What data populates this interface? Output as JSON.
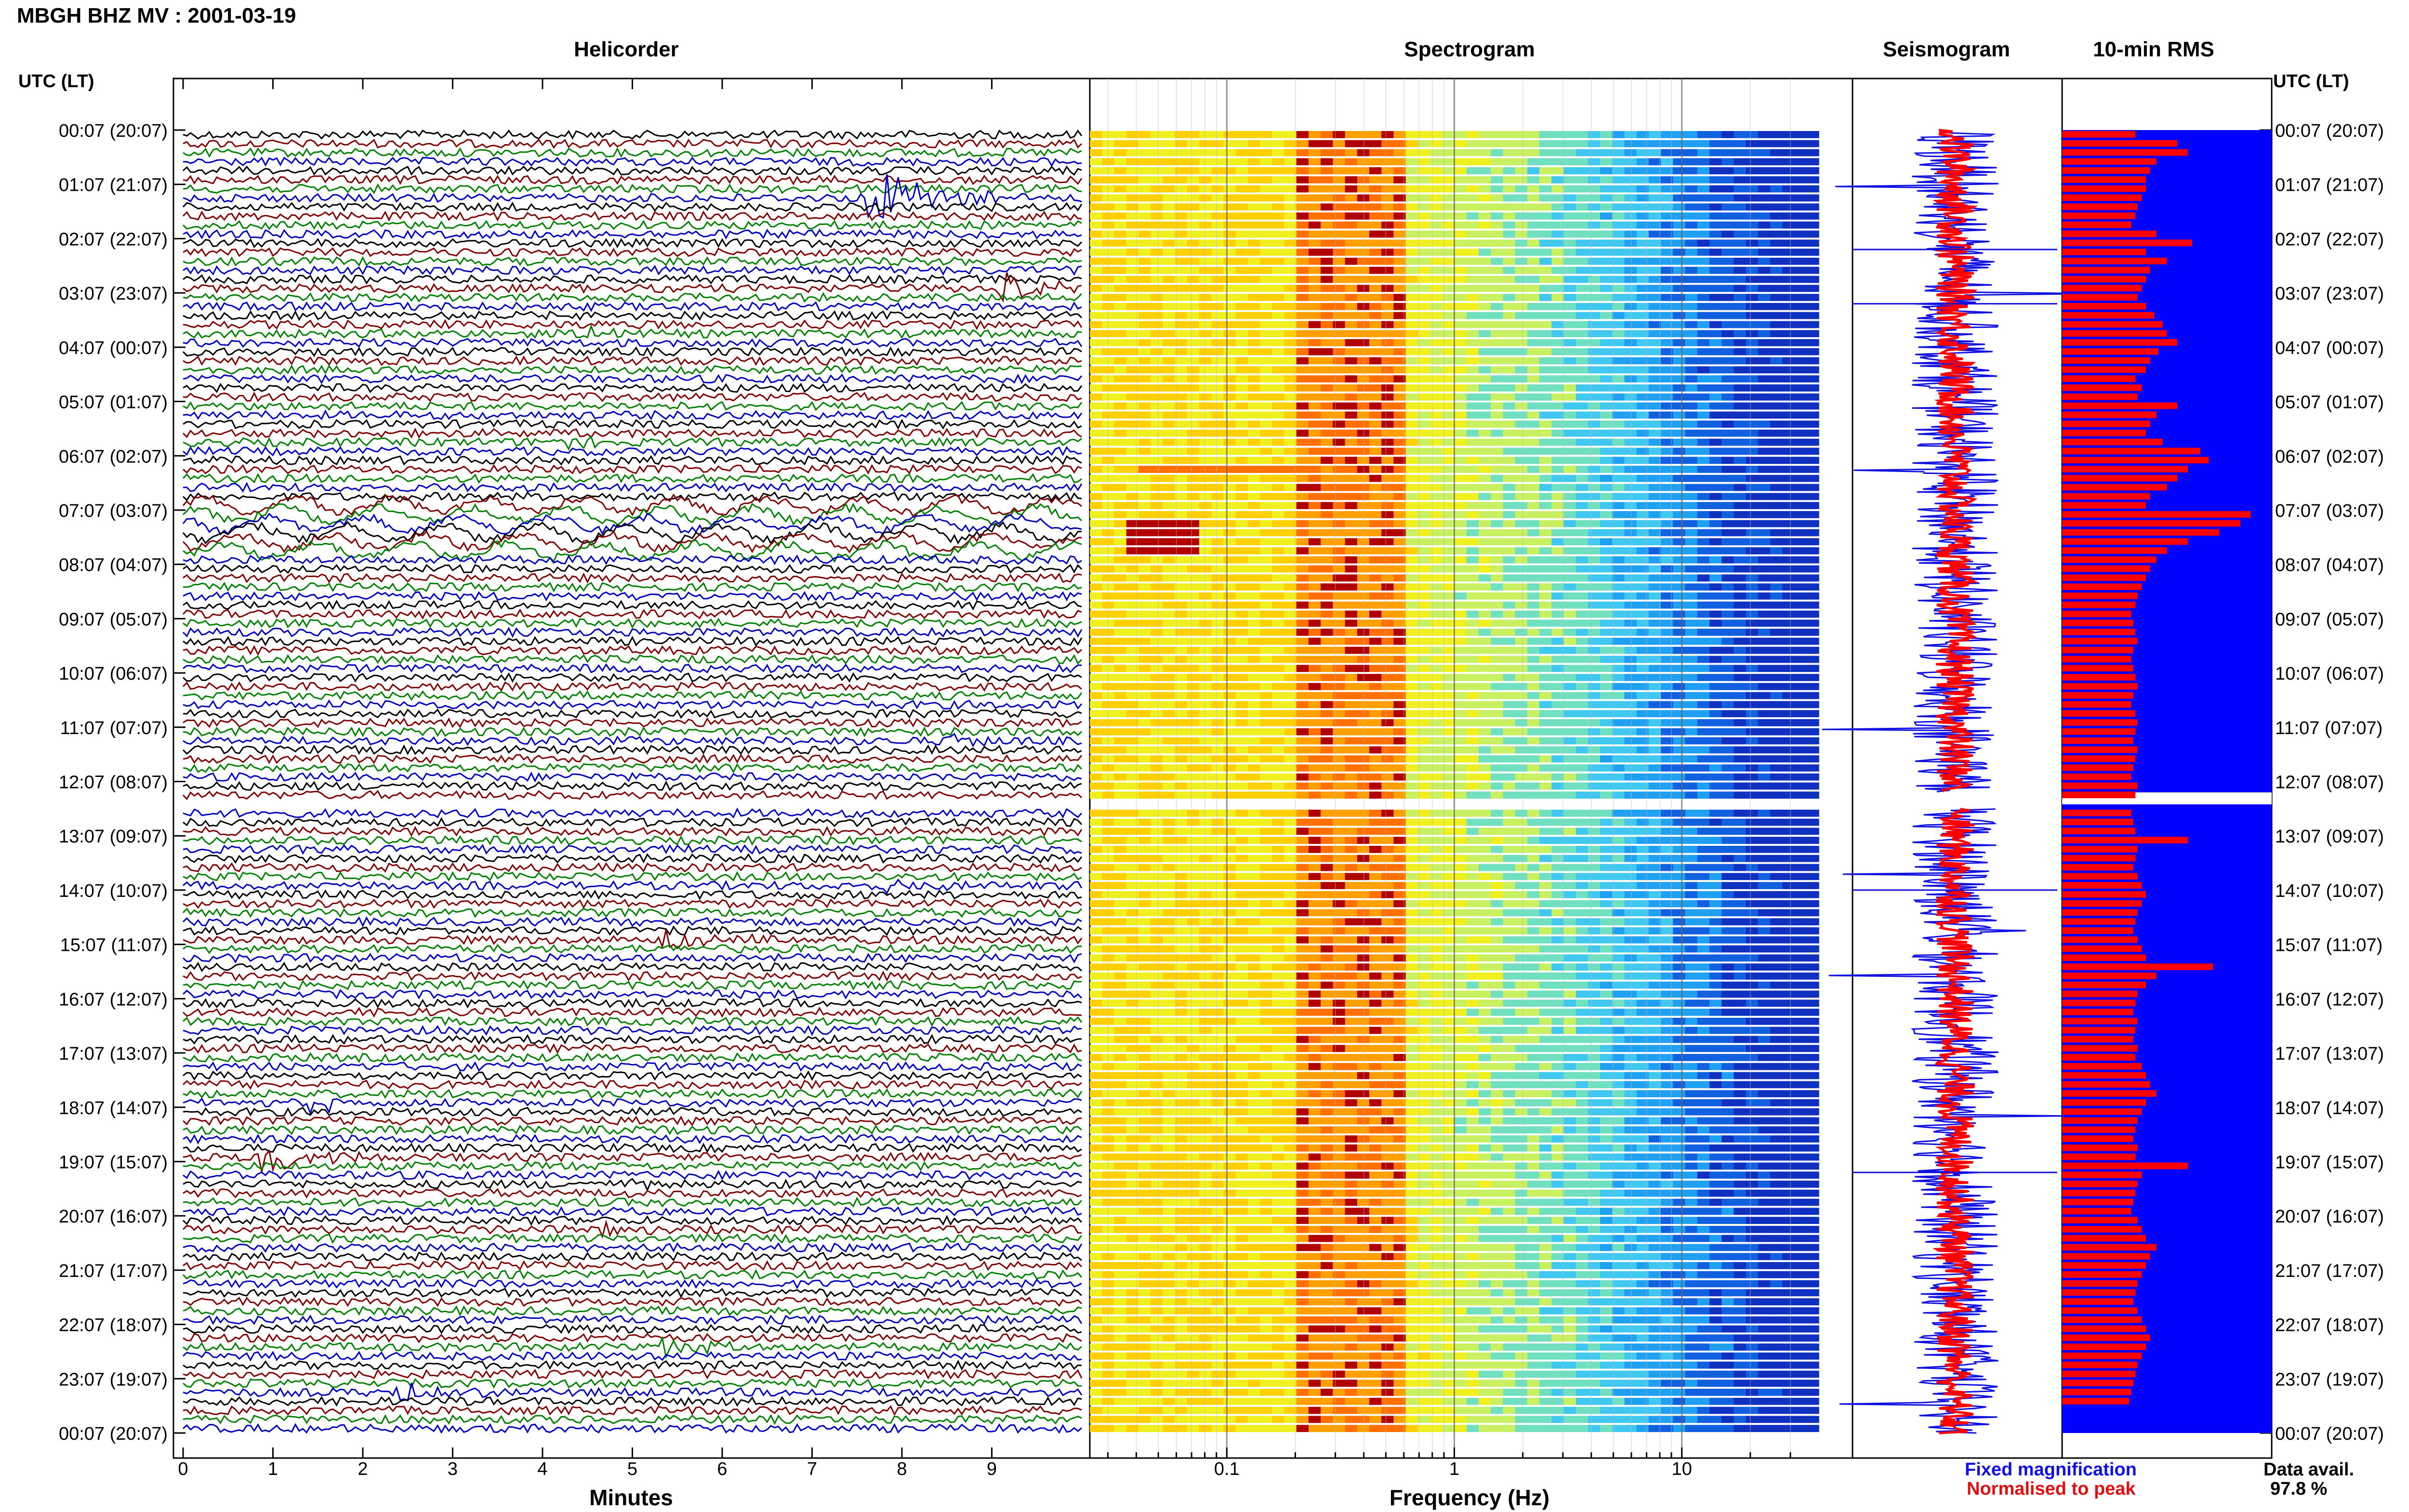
{
  "header": {
    "title": "MBGH BHZ MV : 2001-03-19"
  },
  "panels": {
    "helicorder": "Helicorder",
    "spectrogram": "Spectrogram",
    "seismogram": "Seismogram",
    "rms": "10-min RMS"
  },
  "axis_labels": {
    "left_header": "UTC (LT)",
    "right_header": "UTC (LT)",
    "helicorder_x": "Minutes",
    "spectrogram_x": "Frequency (Hz)"
  },
  "legend": {
    "fixed": "Fixed magnification",
    "normalised": "Normalised to peak",
    "data_avail_label": "Data avail.",
    "data_avail_value": "97.8 %"
  },
  "colors": {
    "trace_cycle": [
      "#000000",
      "#800000",
      "#008000",
      "#0000c0"
    ],
    "seis_fixed": "#1010e0",
    "seis_norm": "#ff0000",
    "rms_bg": "#0000ff",
    "rms_bar": "#ff0000"
  },
  "chart_data": {
    "type": "heatmap",
    "time_labels": [
      "00:07 (20:07)",
      "01:07 (21:07)",
      "02:07 (22:07)",
      "03:07 (23:07)",
      "04:07 (00:07)",
      "05:07 (01:07)",
      "06:07 (02:07)",
      "07:07 (03:07)",
      "08:07 (04:07)",
      "09:07 (05:07)",
      "10:07 (06:07)",
      "11:07 (07:07)",
      "12:07 (08:07)",
      "13:07 (09:07)",
      "14:07 (10:07)",
      "15:07 (11:07)",
      "16:07 (12:07)",
      "17:07 (13:07)",
      "18:07 (14:07)",
      "19:07 (15:07)",
      "20:07 (16:07)",
      "21:07 (17:07)",
      "22:07 (18:07)",
      "23:07 (19:07)",
      "00:07 (20:07)"
    ],
    "helicorder_x_ticks": [
      "0",
      "1",
      "2",
      "3",
      "4",
      "5",
      "6",
      "7",
      "8",
      "9"
    ],
    "helicorder_xlim": [
      0,
      10
    ],
    "spectrogram_x_ticks": [
      "0.1",
      "1",
      "10"
    ],
    "spectrogram_xlim": [
      0.025,
      40
    ],
    "spectrogram_xscale": "log",
    "gap_hours": [
      12.2,
      12.5
    ],
    "helicorder_events": [
      {
        "hour": 1.1,
        "minute": 7.8,
        "color": "maroon",
        "amp": 3.0,
        "width": 0.7
      },
      {
        "hour": 2.8,
        "minute": 9.2,
        "color": "green",
        "amp": 1.6,
        "width": 0.5
      },
      {
        "hour": 3.6,
        "minute": 4.5,
        "color": "black",
        "amp": 0.8,
        "width": 0.2
      },
      {
        "hour": 5.6,
        "minute": 4.2,
        "color": "green",
        "amp": 0.8,
        "width": 0.3
      },
      {
        "hour": 11.2,
        "minute": 8.6,
        "color": "blue",
        "amp": 1.0,
        "width": 0.3
      },
      {
        "hour": 13.8,
        "minute": 7.9,
        "color": "green",
        "amp": 0.6,
        "width": 0.3
      },
      {
        "hour": 14.9,
        "minute": 5.3,
        "color": "black",
        "amp": 1.6,
        "width": 0.5
      },
      {
        "hour": 17.9,
        "minute": 1.5,
        "color": "maroon",
        "amp": 0.9,
        "width": 0.3
      },
      {
        "hour": 18.9,
        "minute": 1.0,
        "color": "green",
        "amp": 1.7,
        "width": 0.5
      },
      {
        "hour": 19.3,
        "minute": 5.0,
        "color": "black",
        "amp": 0.5,
        "width": 0.3
      },
      {
        "hour": 20.2,
        "minute": 4.5,
        "color": "green",
        "amp": 0.8,
        "width": 0.4
      },
      {
        "hour": 22.3,
        "minute": 5.5,
        "color": "green",
        "amp": 0.8,
        "width": 0.6
      },
      {
        "hour": 23.1,
        "minute": 2.5,
        "color": "blue",
        "amp": 1.1,
        "width": 0.5
      }
    ],
    "rms_ten_min_relative": [
      0.35,
      0.55,
      0.6,
      0.45,
      0.42,
      0.4,
      0.4,
      0.38,
      0.36,
      0.35,
      0.33,
      0.45,
      0.62,
      0.4,
      0.5,
      0.42,
      0.4,
      0.38,
      0.36,
      0.4,
      0.44,
      0.48,
      0.5,
      0.55,
      0.46,
      0.42,
      0.4,
      0.35,
      0.38,
      0.36,
      0.55,
      0.45,
      0.42,
      0.4,
      0.48,
      0.66,
      0.7,
      0.6,
      0.55,
      0.5,
      0.42,
      0.4,
      0.9,
      0.85,
      0.75,
      0.6,
      0.5,
      0.45,
      0.42,
      0.4,
      0.38,
      0.36,
      0.35,
      0.33,
      0.34,
      0.35,
      0.36,
      0.34,
      0.33,
      0.34,
      0.35,
      0.36,
      0.34,
      0.33,
      0.35,
      0.36,
      0.35,
      0.34,
      0.36,
      0.35,
      0.34,
      0.33,
      0.36,
      0.35,
      0.34,
      0.33,
      0.34,
      0.35,
      0.6,
      0.36,
      0.35,
      0.34,
      0.36,
      0.38,
      0.4,
      0.38,
      0.36,
      0.35,
      0.34,
      0.36,
      0.38,
      0.4,
      0.72,
      0.45,
      0.4,
      0.36,
      0.35,
      0.34,
      0.36,
      0.35,
      0.34,
      0.36,
      0.35,
      0.38,
      0.4,
      0.42,
      0.45,
      0.4,
      0.38,
      0.36,
      0.35,
      0.34,
      0.36,
      0.35,
      0.6,
      0.38,
      0.36,
      0.35,
      0.34,
      0.33,
      0.36,
      0.38,
      0.4,
      0.45,
      0.42,
      0.4,
      0.38,
      0.36,
      0.35,
      0.34,
      0.36,
      0.38,
      0.4,
      0.42,
      0.4,
      0.38,
      0.36,
      0.35,
      0.34,
      0.33,
      0.32
    ]
  }
}
